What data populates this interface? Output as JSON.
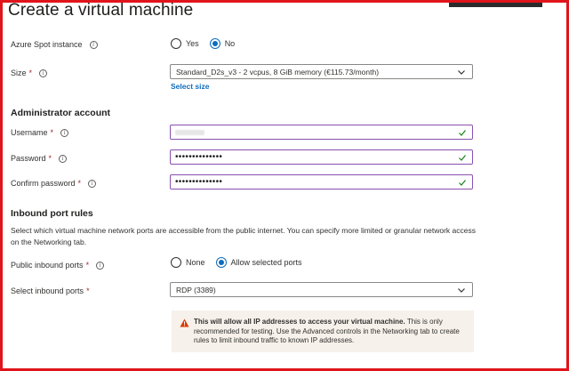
{
  "page": {
    "title": "Create a virtual machine"
  },
  "spot": {
    "label": "Azure Spot instance",
    "options": [
      "Yes",
      "No"
    ],
    "selected": "No"
  },
  "size": {
    "label": "Size",
    "required": "*",
    "value": "Standard_D2s_v3 - 2 vcpus, 8 GiB memory (€115.73/month)",
    "link": "Select size"
  },
  "admin": {
    "heading": "Administrator account",
    "username": {
      "label": "Username",
      "required": "*",
      "value": ""
    },
    "password": {
      "label": "Password",
      "required": "*",
      "value": "••••••••••••••"
    },
    "confirm": {
      "label": "Confirm password",
      "required": "*",
      "value": "••••••••••••••"
    }
  },
  "inbound": {
    "heading": "Inbound port rules",
    "description": "Select which virtual machine network ports are accessible from the public internet. You can specify more limited or granular network access on the Networking tab.",
    "public_label": "Public inbound ports",
    "public_required": "*",
    "public_options": [
      "None",
      "Allow selected ports"
    ],
    "public_selected": "Allow selected ports",
    "select_label": "Select inbound ports",
    "select_required": "*",
    "select_value": "RDP (3389)"
  },
  "warning": {
    "bold": "This will allow all IP addresses to access your virtual machine.",
    "text": " This is only recommended for testing.  Use the Advanced controls in the Networking tab to create rules to limit inbound traffic to known IP addresses."
  },
  "colors": {
    "accent": "#0f6cbd",
    "frame": "#e0141b",
    "valid": "#107c10",
    "warning": "#d83b01"
  },
  "icons": {
    "info": "info-icon",
    "chevron": "chevron-down-icon",
    "check": "checkmark-icon",
    "warning": "warning-icon"
  }
}
